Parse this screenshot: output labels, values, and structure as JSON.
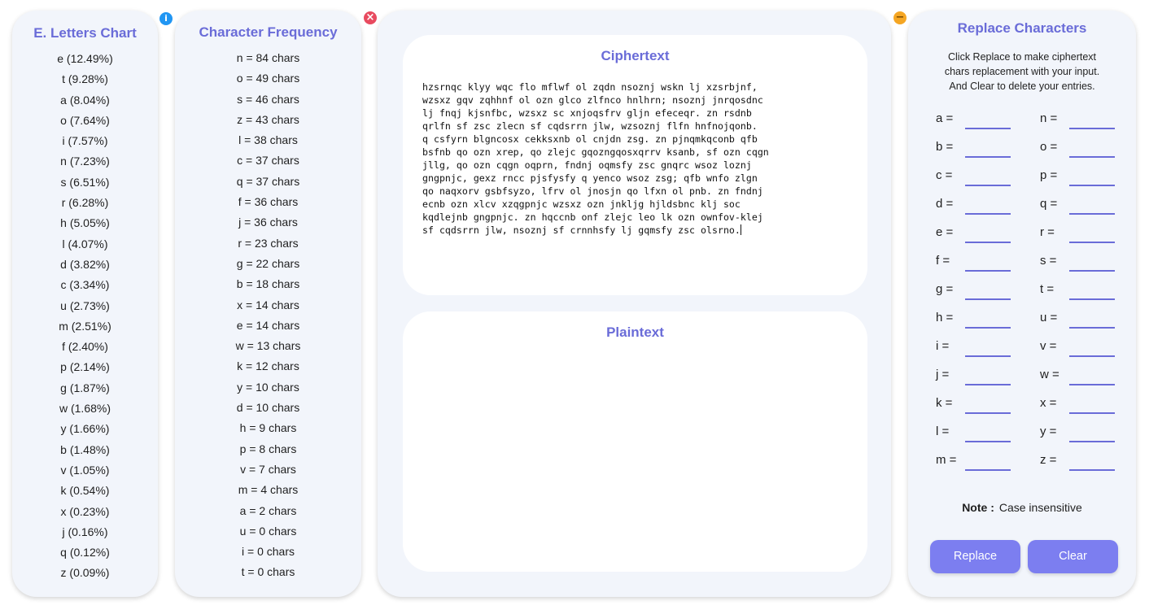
{
  "letters_panel": {
    "title": "E. Letters Chart",
    "items": [
      "e (12.49%)",
      "t (9.28%)",
      "a (8.04%)",
      "o (7.64%)",
      "i (7.57%)",
      "n (7.23%)",
      "s (6.51%)",
      "r (6.28%)",
      "h (5.05%)",
      "l (4.07%)",
      "d (3.82%)",
      "c (3.34%)",
      "u (2.73%)",
      "m (2.51%)",
      "f (2.40%)",
      "p (2.14%)",
      "g (1.87%)",
      "w (1.68%)",
      "y (1.66%)",
      "b (1.48%)",
      "v (1.05%)",
      "k (0.54%)",
      "x (0.23%)",
      "j (0.16%)",
      "q (0.12%)",
      "z (0.09%)"
    ],
    "badge": "i",
    "badge_color": "#2196f3"
  },
  "frequency_panel": {
    "title": "Character Frequency",
    "items": [
      "n = 84 chars",
      "o = 49 chars",
      "s = 46 chars",
      "z = 43 chars",
      "l = 38 chars",
      "c = 37 chars",
      "q = 37 chars",
      "f = 36 chars",
      "j = 36 chars",
      "r = 23 chars",
      "g = 22 chars",
      "b = 18 chars",
      "x = 14 chars",
      "e = 14 chars",
      "w = 13 chars",
      "k = 12 chars",
      "y = 10 chars",
      "d = 10 chars",
      "h = 9 chars",
      "p = 8 chars",
      "v = 7 chars",
      "m = 4 chars",
      "a = 2 chars",
      "u = 0 chars",
      "i = 0 chars",
      "t = 0 chars"
    ],
    "badge": "×",
    "badge_color": "#e84a5f"
  },
  "main_panel": {
    "ciphertext_title": "Ciphertext",
    "ciphertext": "hzsrnqc klyy wqc flo mflwf ol zqdn nsoznj wskn lj xzsrbjnf,\nwzsxz gqv zqhhnf ol ozn glco zlfnco hnlhrn; nsoznj jnrqosdnc\nlj fnqj kjsnfbc, wzsxz sc xnjoqsfrv gljn efeceqr. zn rsdnb\nqrlfn sf zsc zlecn sf cqdsrrn jlw, wzsoznj flfn hnfnojqonb.\nq csfyrn blgncosx cekksxnb ol cnjdn zsg. zn pjnqmkqconb qfb\nbsfnb qo ozn xrep, qo zlejc gqozngqosxqrrv ksanb, sf ozn cqgn\njllg, qo ozn cqgn oqprn, fndnj oqmsfy zsc gnqrc wsoz loznj\ngngpnjc, gexz rncc pjsfysfy q yenco wsoz zsg; qfb wnfo zlgn\nqo naqxorv gsbfsyzo, lfrv ol jnosjn qo lfxn ol pnb. zn fndnj\necnb ozn xlcv xzqgpnjc wzsxz ozn jnkljg hjldsbnc klj soc\nkqdlejnb gngpnjc. zn hqccnb onf zlejc leo lk ozn ownfov-klej\nsf cqdsrrn jlw, nsoznj sf crnnhsfy lj gqmsfy zsc olsrno.",
    "plaintext_title": "Plaintext",
    "plaintext": ""
  },
  "replace_panel": {
    "title": "Replace Characters",
    "description_lines": [
      "Click Replace to make ciphertext",
      "chars replacement with your input.",
      "And Clear to delete your entries."
    ],
    "left_letters": [
      "a =",
      "b =",
      "c =",
      "d =",
      "e =",
      "f =",
      "g =",
      "h =",
      "i =",
      "j =",
      "k =",
      "l =",
      "m ="
    ],
    "right_letters": [
      "n =",
      "o =",
      "p =",
      "q =",
      "r =",
      "s =",
      "t =",
      "u =",
      "v =",
      "w =",
      "x =",
      "y =",
      "z ="
    ],
    "note_label": "Note :",
    "note_text": "Case insensitive",
    "replace_label": "Replace",
    "clear_label": "Clear",
    "badge": "−",
    "badge_color": "#f5a623",
    "accent": "#6a6cd8"
  }
}
